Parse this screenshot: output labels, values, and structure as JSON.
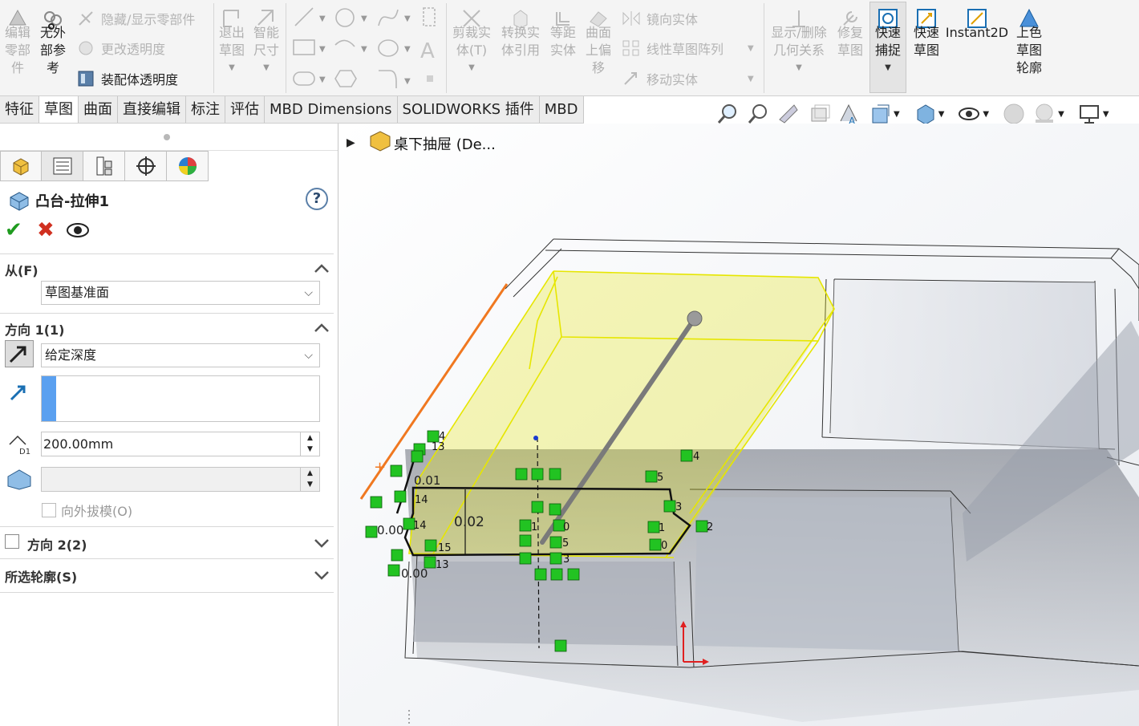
{
  "ribbon": {
    "edit_part": "编辑\n零部\n件",
    "no_ext_ref": "无外\n部参\n考",
    "hide_show": "隐藏/显示零部件",
    "change_transparency": "更改透明度",
    "assembly_transparency": "装配体透明度",
    "exit_sketch": "退出\n草图",
    "smart_dim": "智能\n尺寸",
    "trim": "剪裁实\n体(T)",
    "convert": "转换实\n体引用",
    "offset": "等距\n实体",
    "surface_offset": "曲面\n上偏\n移",
    "mirror": "镜向实体",
    "linear_pattern": "线性草图阵列",
    "move": "移动实体",
    "show_delete_rel": "显示/删除\n几何关系",
    "repair": "修复\n草图",
    "quick_snap": "快速\n捕捉",
    "rapid_sketch": "快速\n草图",
    "instant2d": "Instant2D",
    "shaded_contours": "上色\n草图\n轮廓"
  },
  "tabs": [
    "特征",
    "草图",
    "曲面",
    "直接编辑",
    "标注",
    "评估",
    "MBD Dimensions",
    "SOLIDWORKS 插件",
    "MBD"
  ],
  "active_tab": 1,
  "panel": {
    "title": "凸台-拉伸1",
    "from_label": "从(F)",
    "from_value": "草图基准面",
    "dir1_label": "方向 1(1)",
    "dir1_value": "给定深度",
    "depth": "200.00mm",
    "draft_outward": "向外拔模(O)",
    "dir2_label": "方向 2(2)",
    "selected_contours": "所选轮廓(S)"
  },
  "tree": {
    "root": "桌下抽屉 (De..."
  },
  "dims": {
    "d1": "0.02",
    "d2": "0.01",
    "d3": "0.00",
    "d4": "0.00"
  },
  "colors": {
    "accent_green": "#1f9b1f",
    "accent_red": "#d03020",
    "highlight_yellow": "#e6e600",
    "edge_orange": "#f07820",
    "relation_green": "#22c322"
  }
}
